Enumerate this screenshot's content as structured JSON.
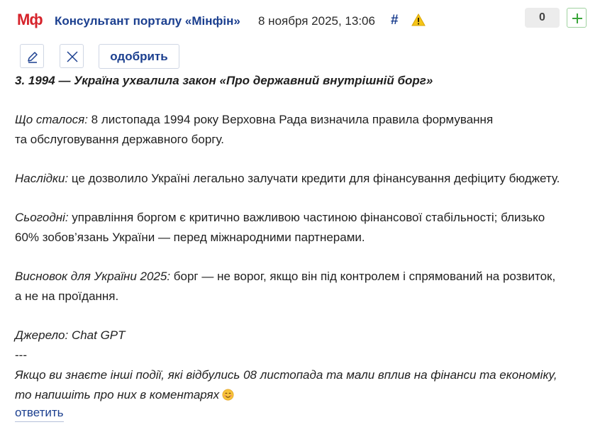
{
  "header": {
    "logo": "Мф",
    "author": "Консультант порталу «Мінфін»",
    "date": "8 ноября 2025, 13:06",
    "hash": "#",
    "counter": "0"
  },
  "toolbar": {
    "approve_label": "одобрить"
  },
  "post": {
    "heading": "3. 1994 — Україна ухвалила закон «Про державний внутрішній борг»",
    "p1_label": "Що сталося:",
    "p1_line1": " 8 листопада 1994 року Верховна Рада визначила правила формування",
    "p1_line2": "та обслуговування державного боргу.",
    "p2_label": "Наслідки:",
    "p2_text": " це дозволило Україні легально залучати кредити для фінансування дефіциту бюджету.",
    "p3_label": "Сьогодні:",
    "p3_line1": " управління боргом є критично важливою частиною фінансової стабільності; близько",
    "p3_line2": "60% зобов’язань України — перед міжнародними партнерами.",
    "p4_label": "Висновок для України 2025:",
    "p4_line1": " борг — не ворог, якщо він під контролем і спрямований на розвиток,",
    "p4_line2": "а не на проїдання.",
    "source": "Джерело: Chat GPT",
    "divider": "---",
    "closing_line1": "Якщо ви знаєте інші події, які відбулись 08 листопада та мали вплив на фінанси та економіку,",
    "closing_line2": "то напишіть про них в коментарях"
  },
  "reply_label": "ответить",
  "icons": {
    "warning": "warning-icon",
    "edit": "pencil-icon",
    "delete": "close-icon",
    "plus": "plus-icon",
    "emoji": "smiling-face-icon"
  },
  "colors": {
    "logo": "#d6232b",
    "link": "#1b3f8f",
    "plus": "#3aa63a",
    "counter_bg": "#ececec"
  }
}
